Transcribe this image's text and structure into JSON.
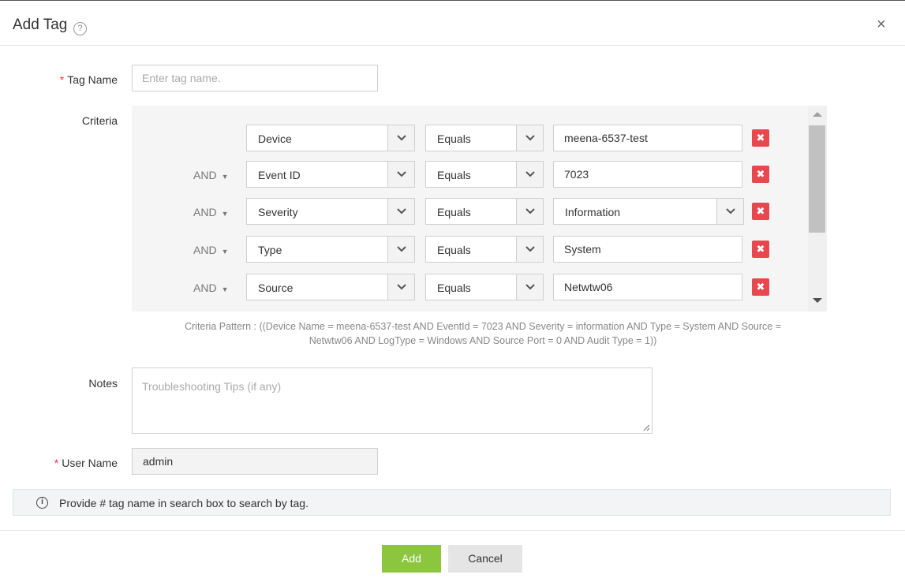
{
  "dialog": {
    "title": "Add Tag",
    "help_symbol": "?",
    "close_symbol": "×"
  },
  "form": {
    "tag_name_label": "Tag Name",
    "tag_name_placeholder": "Enter tag name.",
    "criteria_label": "Criteria",
    "notes_label": "Notes",
    "notes_placeholder": "Troubleshooting Tips (if any)",
    "user_name_label": "User Name",
    "user_name_value": "admin",
    "required_mark": "*"
  },
  "criteria": {
    "rows": [
      {
        "connector": "",
        "field": "Device",
        "operator": "Equals",
        "value": "meena-6537-test",
        "value_is_select": false
      },
      {
        "connector": "AND",
        "field": "Event ID",
        "operator": "Equals",
        "value": "7023",
        "value_is_select": false
      },
      {
        "connector": "AND",
        "field": "Severity",
        "operator": "Equals",
        "value": "Information",
        "value_is_select": true
      },
      {
        "connector": "AND",
        "field": "Type",
        "operator": "Equals",
        "value": "System",
        "value_is_select": false
      },
      {
        "connector": "AND",
        "field": "Source",
        "operator": "Equals",
        "value": "Netwtw06",
        "value_is_select": false
      }
    ],
    "delete_symbol": "✖",
    "pattern_line1": "Criteria Pattern : ((Device Name = meena-6537-test AND EventId = 7023 AND Severity = information AND Type = System AND Source =",
    "pattern_line2": "Netwtw06 AND LogType = Windows AND Source Port = 0 AND Audit Type = 1))"
  },
  "info": {
    "icon": "i",
    "text": "Provide # tag name in search box to search by tag."
  },
  "buttons": {
    "add": "Add",
    "cancel": "Cancel"
  },
  "colors": {
    "add_button": "#8cc63f",
    "delete_button": "#e8474d",
    "required": "#e53935"
  }
}
